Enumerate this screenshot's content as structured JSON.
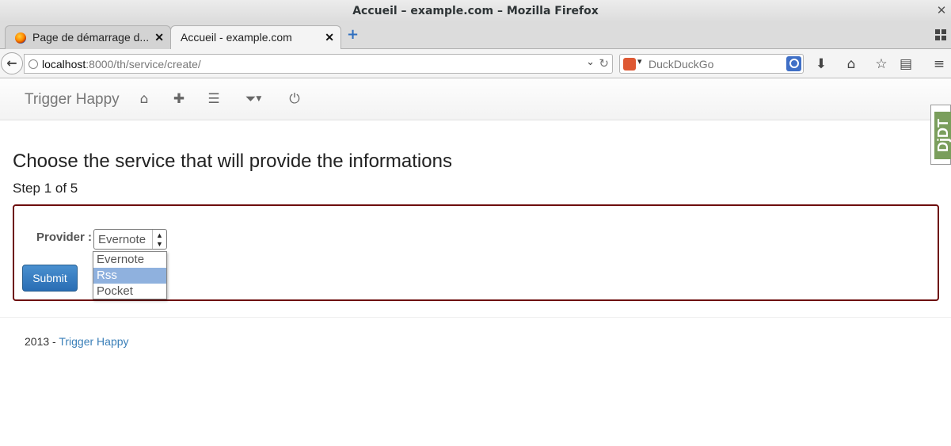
{
  "window": {
    "title": "Accueil – example.com – Mozilla Firefox",
    "close_glyph": "✕"
  },
  "tabs": [
    {
      "label": "Page de démarrage d...",
      "active": false,
      "close_glyph": "✕"
    },
    {
      "label": "Accueil - example.com",
      "active": true,
      "close_glyph": "✕"
    }
  ],
  "new_tab_glyph": "+",
  "navbar": {
    "back_glyph": "←",
    "url_host": "localhost",
    "url_rest": ":8000/th/service/create/",
    "search_placeholder": "DuckDuckGo",
    "search_engine": "DuckDuckGo",
    "icons": [
      "download-icon",
      "home-icon",
      "bookmark-star-icon",
      "reading-list-icon",
      "menu-icon"
    ]
  },
  "app": {
    "brand": "Trigger Happy",
    "nav_icons": [
      "home-icon",
      "plus-icon",
      "list-icon",
      "filter-icon",
      "power-icon"
    ],
    "debug_toolbar": "DjDT"
  },
  "main": {
    "heading": "Choose the service that will provide the informations",
    "step": "Step 1 of 5",
    "form": {
      "provider_label": "Provider :",
      "selected_value": "Evernote",
      "submit_label": "Submit",
      "options": [
        "Evernote",
        "Rss",
        "Pocket"
      ],
      "highlighted_option": "Rss"
    }
  },
  "footer": {
    "year": "2013 - ",
    "link": "Trigger Happy"
  },
  "colors": {
    "accent": "#2a6db4",
    "form_border": "#6d0d0d",
    "highlight": "#8fb1de",
    "link": "#3a7fb8"
  }
}
